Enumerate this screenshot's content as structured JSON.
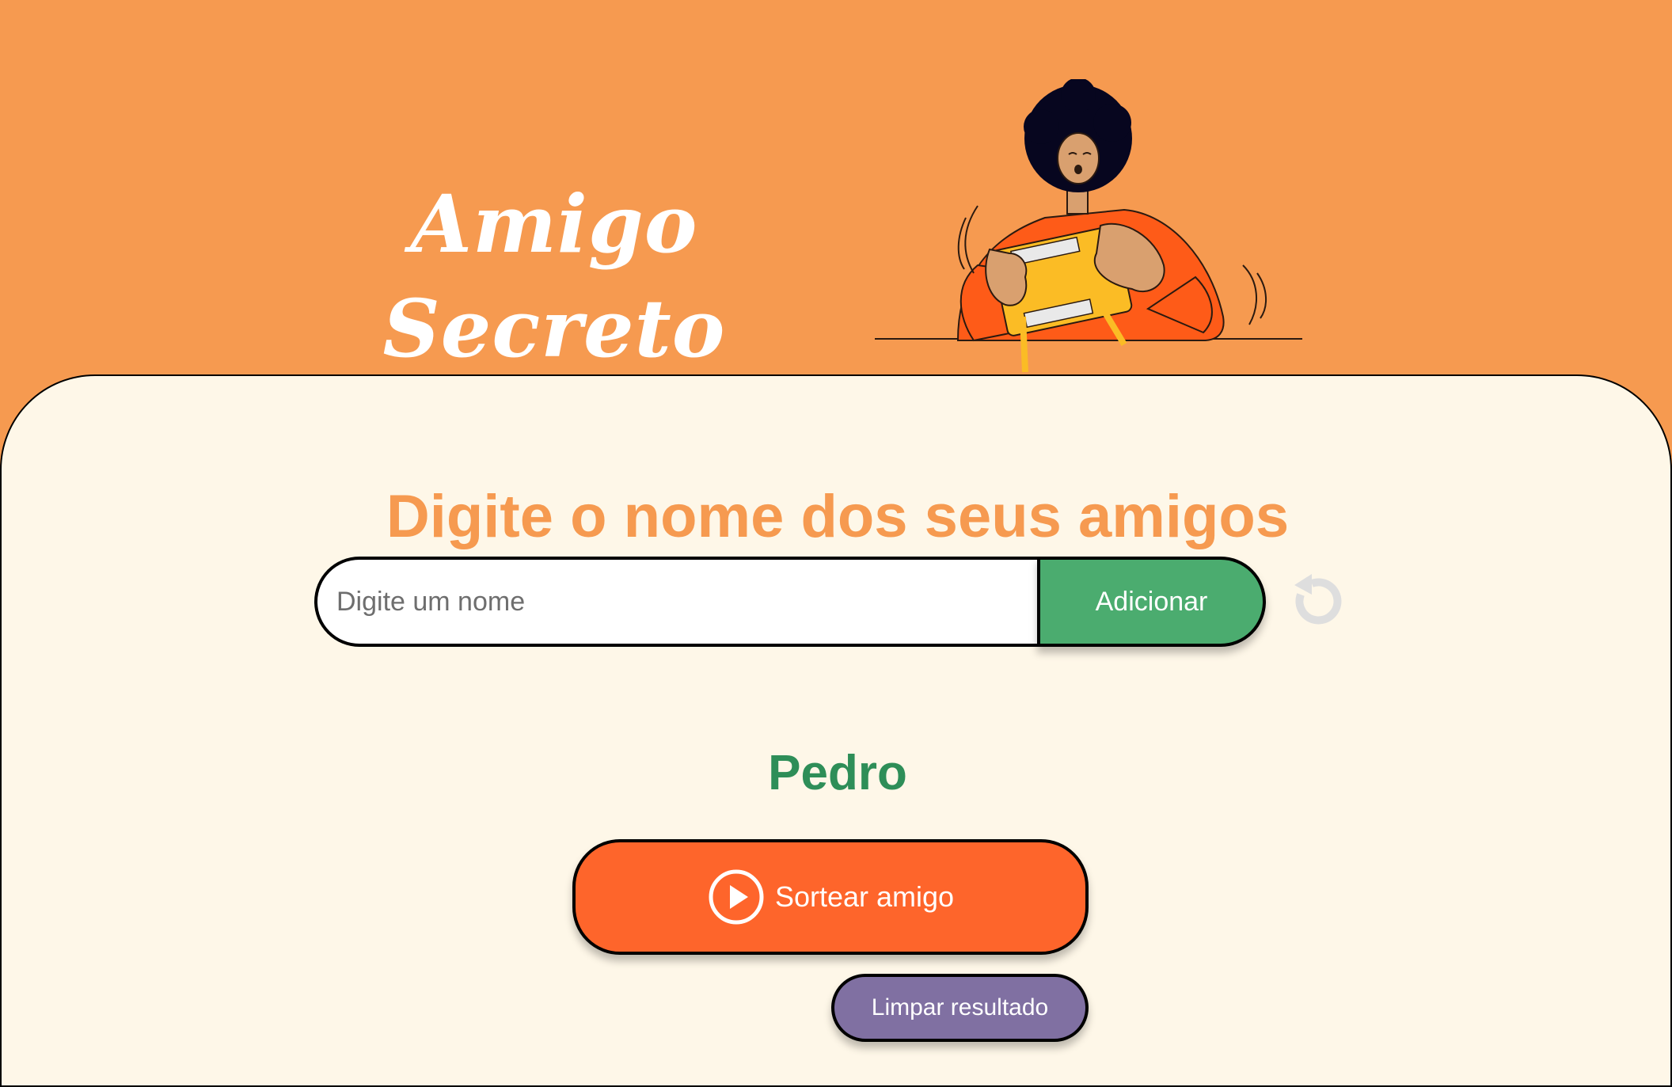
{
  "header": {
    "title_line1": "Amigo",
    "title_line2": "Secreto",
    "illustration_icon": "person-holding-gift-illustration"
  },
  "main": {
    "heading": "Digite o nome dos seus amigos",
    "input": {
      "placeholder": "Digite um nome",
      "value": ""
    },
    "add_button_label": "Adicionar",
    "reset_icon": "reset-icon",
    "result": "Pedro",
    "draw_button_label": "Sortear amigo",
    "draw_button_icon": "play-circle-icon",
    "clear_button_label": "Limpar resultado"
  },
  "colors": {
    "header_bg": "#F69A50",
    "main_bg": "#FEF7E8",
    "heading": "#F69A50",
    "add_button": "#4BAC6F",
    "result_text": "#2E8E58",
    "draw_button": "#FE652B",
    "clear_button": "#8070A2"
  }
}
